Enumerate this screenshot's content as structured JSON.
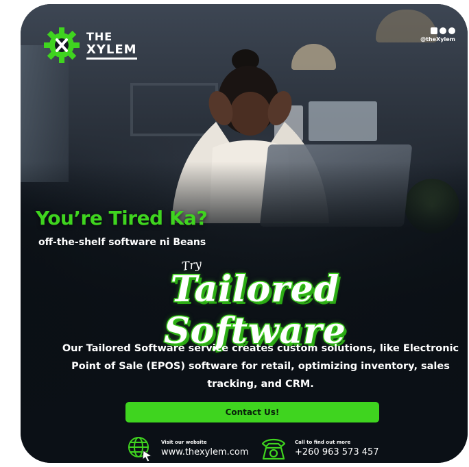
{
  "brand": {
    "the": "THE",
    "name": "XYLEM",
    "accent_color": "#3fd41f"
  },
  "social": {
    "icons": [
      "linkedin-icon",
      "instagram-icon",
      "facebook-icon"
    ],
    "handle": "@theXylem"
  },
  "headline": "You’re Tired Ka?",
  "subline": "off-the-shelf software ni Beans",
  "try_label": "Try",
  "title": "Tailored Software",
  "description": "Our Tailored Software service creates custom solutions, like Electronic Point of Sale (EPOS) software for retail, optimizing inventory, sales tracking, and CRM.",
  "cta_label": "Contact Us!",
  "website": {
    "label": "Visit our website",
    "value": "www.thexylem.com",
    "icon": "globe-cursor-icon"
  },
  "phone": {
    "label": "Call to find out more",
    "value": "+260 963 573 457",
    "icon": "telephone-icon"
  }
}
